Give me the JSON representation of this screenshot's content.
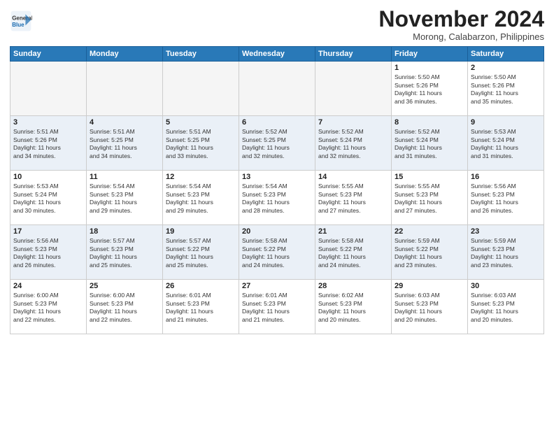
{
  "header": {
    "logo_line1": "General",
    "logo_line2": "Blue",
    "month_title": "November 2024",
    "location": "Morong, Calabarzon, Philippines"
  },
  "weekdays": [
    "Sunday",
    "Monday",
    "Tuesday",
    "Wednesday",
    "Thursday",
    "Friday",
    "Saturday"
  ],
  "weeks": [
    [
      {
        "day": "",
        "info": ""
      },
      {
        "day": "",
        "info": ""
      },
      {
        "day": "",
        "info": ""
      },
      {
        "day": "",
        "info": ""
      },
      {
        "day": "",
        "info": ""
      },
      {
        "day": "1",
        "info": "Sunrise: 5:50 AM\nSunset: 5:26 PM\nDaylight: 11 hours\nand 36 minutes."
      },
      {
        "day": "2",
        "info": "Sunrise: 5:50 AM\nSunset: 5:26 PM\nDaylight: 11 hours\nand 35 minutes."
      }
    ],
    [
      {
        "day": "3",
        "info": "Sunrise: 5:51 AM\nSunset: 5:26 PM\nDaylight: 11 hours\nand 34 minutes."
      },
      {
        "day": "4",
        "info": "Sunrise: 5:51 AM\nSunset: 5:25 PM\nDaylight: 11 hours\nand 34 minutes."
      },
      {
        "day": "5",
        "info": "Sunrise: 5:51 AM\nSunset: 5:25 PM\nDaylight: 11 hours\nand 33 minutes."
      },
      {
        "day": "6",
        "info": "Sunrise: 5:52 AM\nSunset: 5:25 PM\nDaylight: 11 hours\nand 32 minutes."
      },
      {
        "day": "7",
        "info": "Sunrise: 5:52 AM\nSunset: 5:24 PM\nDaylight: 11 hours\nand 32 minutes."
      },
      {
        "day": "8",
        "info": "Sunrise: 5:52 AM\nSunset: 5:24 PM\nDaylight: 11 hours\nand 31 minutes."
      },
      {
        "day": "9",
        "info": "Sunrise: 5:53 AM\nSunset: 5:24 PM\nDaylight: 11 hours\nand 31 minutes."
      }
    ],
    [
      {
        "day": "10",
        "info": "Sunrise: 5:53 AM\nSunset: 5:24 PM\nDaylight: 11 hours\nand 30 minutes."
      },
      {
        "day": "11",
        "info": "Sunrise: 5:54 AM\nSunset: 5:23 PM\nDaylight: 11 hours\nand 29 minutes."
      },
      {
        "day": "12",
        "info": "Sunrise: 5:54 AM\nSunset: 5:23 PM\nDaylight: 11 hours\nand 29 minutes."
      },
      {
        "day": "13",
        "info": "Sunrise: 5:54 AM\nSunset: 5:23 PM\nDaylight: 11 hours\nand 28 minutes."
      },
      {
        "day": "14",
        "info": "Sunrise: 5:55 AM\nSunset: 5:23 PM\nDaylight: 11 hours\nand 27 minutes."
      },
      {
        "day": "15",
        "info": "Sunrise: 5:55 AM\nSunset: 5:23 PM\nDaylight: 11 hours\nand 27 minutes."
      },
      {
        "day": "16",
        "info": "Sunrise: 5:56 AM\nSunset: 5:23 PM\nDaylight: 11 hours\nand 26 minutes."
      }
    ],
    [
      {
        "day": "17",
        "info": "Sunrise: 5:56 AM\nSunset: 5:23 PM\nDaylight: 11 hours\nand 26 minutes."
      },
      {
        "day": "18",
        "info": "Sunrise: 5:57 AM\nSunset: 5:23 PM\nDaylight: 11 hours\nand 25 minutes."
      },
      {
        "day": "19",
        "info": "Sunrise: 5:57 AM\nSunset: 5:22 PM\nDaylight: 11 hours\nand 25 minutes."
      },
      {
        "day": "20",
        "info": "Sunrise: 5:58 AM\nSunset: 5:22 PM\nDaylight: 11 hours\nand 24 minutes."
      },
      {
        "day": "21",
        "info": "Sunrise: 5:58 AM\nSunset: 5:22 PM\nDaylight: 11 hours\nand 24 minutes."
      },
      {
        "day": "22",
        "info": "Sunrise: 5:59 AM\nSunset: 5:22 PM\nDaylight: 11 hours\nand 23 minutes."
      },
      {
        "day": "23",
        "info": "Sunrise: 5:59 AM\nSunset: 5:23 PM\nDaylight: 11 hours\nand 23 minutes."
      }
    ],
    [
      {
        "day": "24",
        "info": "Sunrise: 6:00 AM\nSunset: 5:23 PM\nDaylight: 11 hours\nand 22 minutes."
      },
      {
        "day": "25",
        "info": "Sunrise: 6:00 AM\nSunset: 5:23 PM\nDaylight: 11 hours\nand 22 minutes."
      },
      {
        "day": "26",
        "info": "Sunrise: 6:01 AM\nSunset: 5:23 PM\nDaylight: 11 hours\nand 21 minutes."
      },
      {
        "day": "27",
        "info": "Sunrise: 6:01 AM\nSunset: 5:23 PM\nDaylight: 11 hours\nand 21 minutes."
      },
      {
        "day": "28",
        "info": "Sunrise: 6:02 AM\nSunset: 5:23 PM\nDaylight: 11 hours\nand 20 minutes."
      },
      {
        "day": "29",
        "info": "Sunrise: 6:03 AM\nSunset: 5:23 PM\nDaylight: 11 hours\nand 20 minutes."
      },
      {
        "day": "30",
        "info": "Sunrise: 6:03 AM\nSunset: 5:23 PM\nDaylight: 11 hours\nand 20 minutes."
      }
    ]
  ]
}
